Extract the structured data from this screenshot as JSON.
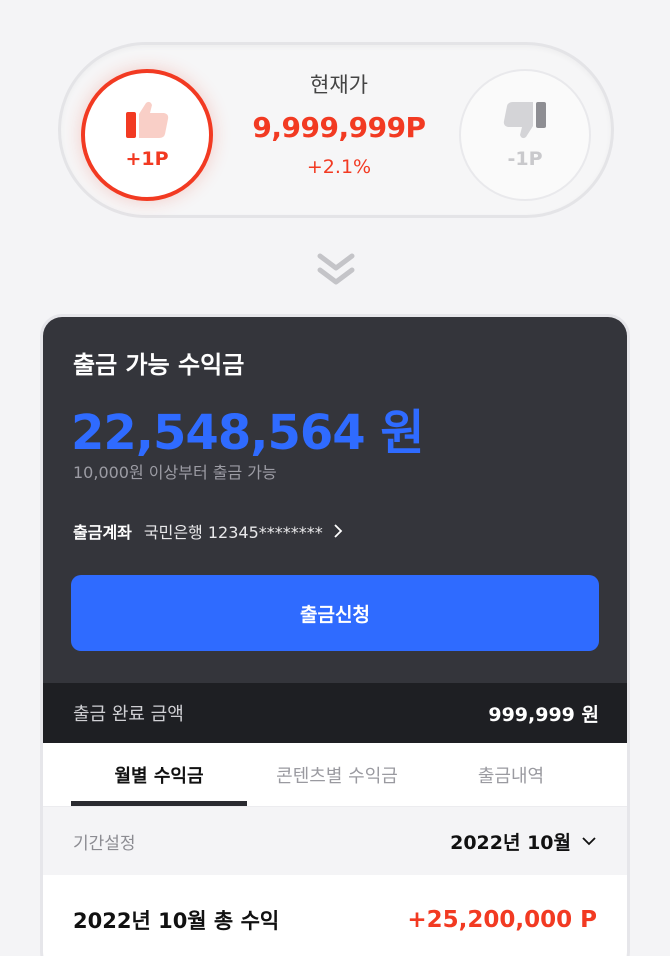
{
  "vote": {
    "up_label": "+1P",
    "down_label": "-1P",
    "caption": "현재가",
    "price": "9,999,999P",
    "change": "+2.1%",
    "colors": {
      "up": "#f23a22",
      "down": "#c9c9cc"
    }
  },
  "earnings": {
    "title": "출금 가능 수익금",
    "amount": "22,548,564 원",
    "note": "10,000원 이상부터 출금 가능",
    "account_label": "출금계좌",
    "account_value": "국민은행 12345********",
    "withdraw_button": "출금신청",
    "done_label": "출금 완료 금액",
    "done_amount": "999,999 원",
    "accent_color": "#2f6bff"
  },
  "tabs": [
    {
      "label": "월별 수익금",
      "active": true
    },
    {
      "label": "콘텐츠별 수익금",
      "active": false
    },
    {
      "label": "출금내역",
      "active": false
    }
  ],
  "period": {
    "label": "기간설정",
    "selected": "2022년 10월"
  },
  "total": {
    "label": "2022년 10월 총 수익",
    "amount": "+25,200,000 P"
  }
}
